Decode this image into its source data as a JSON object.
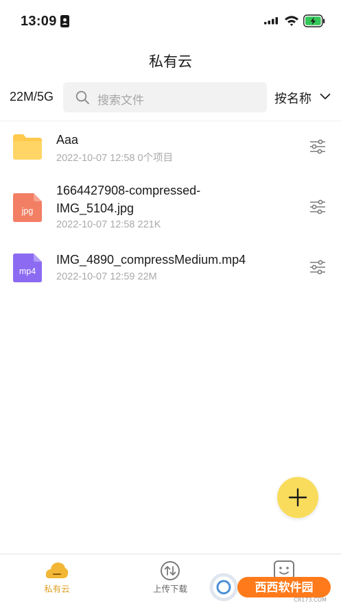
{
  "status_bar": {
    "time": "13:09"
  },
  "header": {
    "title": "私有云"
  },
  "toolbar": {
    "storage_usage": "22M/5G",
    "search_placeholder": "搜索文件",
    "sort_label": "按名称"
  },
  "files": [
    {
      "name": "Aaa",
      "date": "2022-10-07 12:58",
      "size": "0个项目",
      "type": "folder",
      "icon_label": ""
    },
    {
      "name_line1": "1664427908-compressed-",
      "name_line2": "IMG_5104.jpg",
      "date": "2022-10-07 12:58",
      "size": "221K",
      "type": "jpg",
      "icon_label": "jpg"
    },
    {
      "name": "IMG_4890_compressMedium.mp4",
      "date": "2022-10-07 12:59",
      "size": "22M",
      "type": "mp4",
      "icon_label": "mp4"
    }
  ],
  "tabbar": {
    "tabs": [
      {
        "label": "私有云",
        "active": true
      },
      {
        "label": "上传下载",
        "active": false
      },
      {
        "label": "",
        "active": false
      }
    ]
  },
  "colors": {
    "accent": "#f2b736",
    "fab": "#f9dc5c",
    "folder": "#ffc94d",
    "jpg": "#f27e63",
    "mp4": "#8c6bf2",
    "battery": "#34c759"
  },
  "watermark": {
    "text": "西西软件园",
    "domain": "CR173.COM"
  }
}
